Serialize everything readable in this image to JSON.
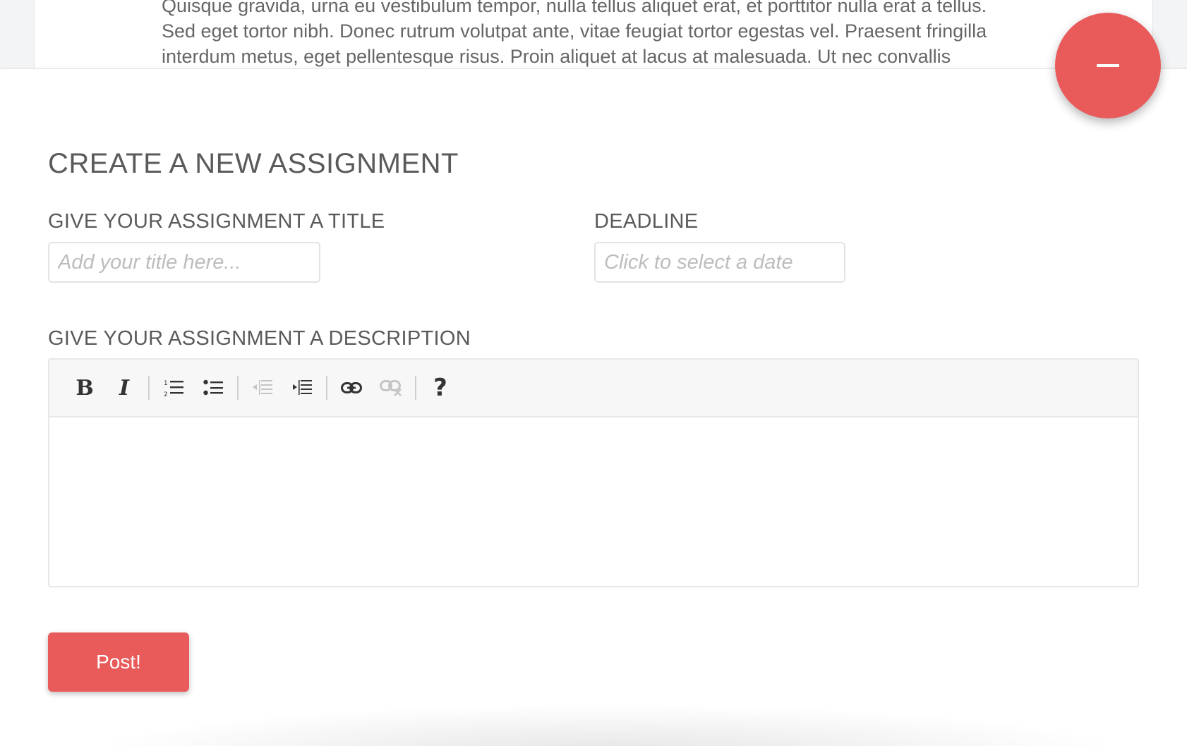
{
  "background_card": {
    "lines": [
      "Quisque gravida, urna eu vestibulum tempor, nulla tellus aliquet erat, et porttitor nulla erat a tellus.",
      "Sed eget tortor nibh. Donec rutrum volutpat ante, vitae feugiat tortor egestas vel. Praesent fringilla",
      "interdum metus, eget pellentesque risus. Proin aliquet at lacus at malesuada. Ut nec convallis"
    ]
  },
  "form": {
    "heading": "CREATE A NEW ASSIGNMENT",
    "title_label": "GIVE YOUR ASSIGNMENT A TITLE",
    "title_placeholder": "Add your title here...",
    "deadline_label": "DEADLINE",
    "deadline_placeholder": "Click to select a date",
    "description_label": "GIVE YOUR ASSIGNMENT A DESCRIPTION",
    "post_label": "Post!"
  },
  "toolbar": {
    "bold": "B",
    "italic": "I",
    "help": "?"
  },
  "colors": {
    "accent": "#e95b5b"
  },
  "icons": {
    "fab": "minus-icon",
    "ordered_list": "ordered-list-icon",
    "unordered_list": "unordered-list-icon",
    "outdent": "outdent-icon",
    "indent": "indent-icon",
    "link": "link-icon",
    "unlink": "unlink-icon"
  }
}
